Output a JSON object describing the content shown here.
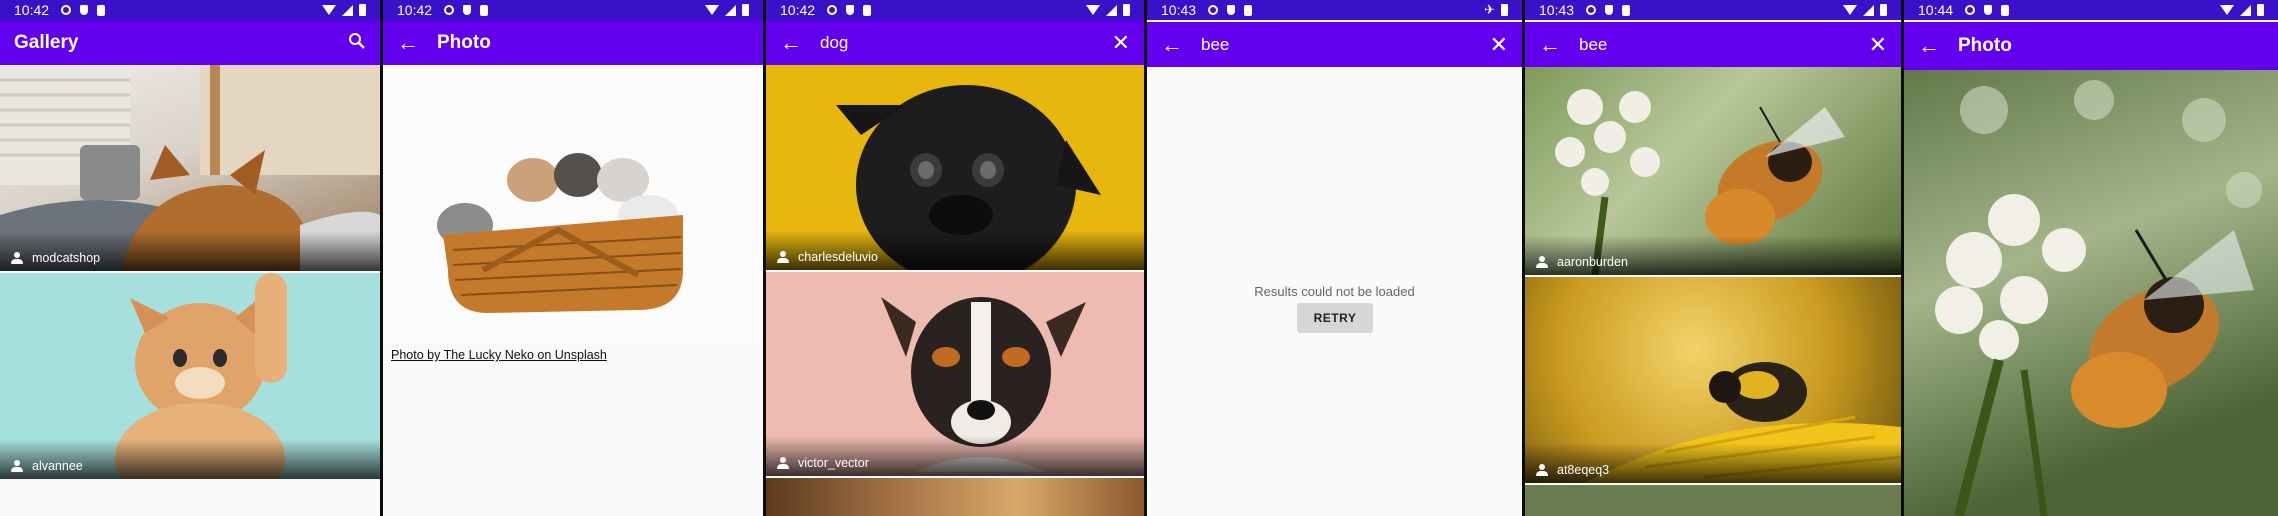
{
  "screens": [
    {
      "time": "10:42",
      "title": "Gallery",
      "action_icon": "search-icon",
      "items": [
        {
          "author": "modcatshop"
        },
        {
          "author": "alvannee"
        }
      ]
    },
    {
      "time": "10:42",
      "title": "Photo",
      "credit": "Photo by The Lucky Neko on Unsplash"
    },
    {
      "time": "10:42",
      "query": "dog",
      "items": [
        {
          "author": "charlesdeluvio"
        },
        {
          "author": "victor_vector"
        }
      ]
    },
    {
      "time": "10:43",
      "query": "bee",
      "error": "Results could not be loaded",
      "retry": "RETRY"
    },
    {
      "time": "10:43",
      "query": "bee",
      "items": [
        {
          "author": "aaronburden"
        },
        {
          "author": "at8eqeq3"
        }
      ]
    },
    {
      "time": "10:44",
      "title": "Photo"
    }
  ],
  "colors": {
    "status_bar": "#3a10c8",
    "app_bar": "#6200ee"
  }
}
